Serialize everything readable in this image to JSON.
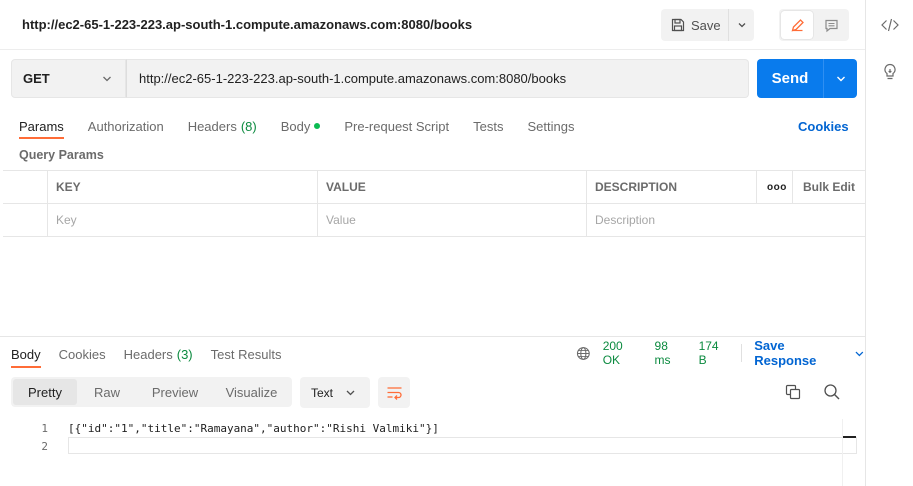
{
  "request": {
    "title": "http://ec2-65-1-223-223.ap-south-1.compute.amazonaws.com:8080/books",
    "save_label": "Save",
    "method": "GET",
    "url": "http://ec2-65-1-223-223.ap-south-1.compute.amazonaws.com:8080/books",
    "send_label": "Send"
  },
  "request_tabs": [
    {
      "label": "Params",
      "active": true
    },
    {
      "label": "Authorization"
    },
    {
      "label": "Headers",
      "count": "(8)"
    },
    {
      "label": "Body"
    },
    {
      "label": "Pre-request Script"
    },
    {
      "label": "Tests"
    },
    {
      "label": "Settings"
    }
  ],
  "cookies_label": "Cookies",
  "query_params": {
    "section_label": "Query Params",
    "headers": {
      "key": "KEY",
      "value": "VALUE",
      "description": "DESCRIPTION",
      "more": "ooo",
      "bulk_edit": "Bulk Edit"
    },
    "placeholders": {
      "key": "Key",
      "value": "Value",
      "description": "Description"
    }
  },
  "response": {
    "tabs": [
      {
        "label": "Body",
        "active": true
      },
      {
        "label": "Cookies"
      },
      {
        "label": "Headers",
        "count": "(3)"
      },
      {
        "label": "Test Results"
      }
    ],
    "status": "200 OK",
    "time": "98 ms",
    "size": "174 B",
    "save_response_label": "Save Response",
    "views": [
      {
        "label": "Pretty",
        "active": true
      },
      {
        "label": "Raw"
      },
      {
        "label": "Preview"
      },
      {
        "label": "Visualize"
      }
    ],
    "format": "Text",
    "lines": [
      {
        "num": "1",
        "text": "[{\"id\":\"1\",\"title\":\"Ramayana\",\"author\":\"Rishi Valmiki\"}]"
      },
      {
        "num": "2",
        "text": ""
      }
    ]
  },
  "colors": {
    "accent": "#ff6c37",
    "send": "#097bed",
    "link": "#0265d2",
    "success": "#0b8a3f"
  },
  "icons": [
    "save-icon",
    "chevron-down-icon",
    "edit-icon",
    "comment-icon",
    "code-icon",
    "lightbulb-icon",
    "globe-icon",
    "wrap-lines-icon",
    "copy-icon",
    "search-icon"
  ]
}
